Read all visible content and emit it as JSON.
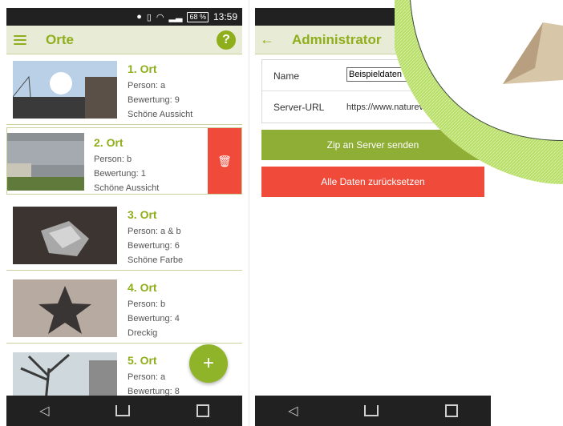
{
  "left_screen": {
    "status": {
      "battery": "68 %",
      "time": "13:59"
    },
    "appbar": {
      "title": "Orte"
    },
    "places": [
      {
        "title": "1. Ort",
        "person": "Person: a",
        "rating": "Bewertung: 9",
        "note": "Schöne Aussicht"
      },
      {
        "title": "2. Ort",
        "person": "Person: b",
        "rating": "Bewertung: 1",
        "note": "Schöne Aussicht"
      },
      {
        "title": "3. Ort",
        "person": "Person: a & b",
        "rating": "Bewertung: 6",
        "note": "Schöne Farbe"
      },
      {
        "title": "4. Ort",
        "person": "Person: b",
        "rating": "Bewertung: 4",
        "note": "Dreckig"
      },
      {
        "title": "5. Ort",
        "person": "Person: a",
        "rating": "Bewertung: 8",
        "note": ""
      }
    ],
    "fab_label": "+"
  },
  "right_screen": {
    "appbar": {
      "title": "Administrator"
    },
    "fields": {
      "name_label": "Name",
      "name_value": "Beispieldaten",
      "server_label": "Server-URL",
      "server_value": "https://www.naturevie"
    },
    "buttons": {
      "send": "Zip an Server senden",
      "reset": "Alle Daten zurücksetzen"
    }
  },
  "colors": {
    "accent": "#8fae1b",
    "delete": "#f04a3a",
    "appbar_bg": "#e8ecd6",
    "system_bar": "#212121"
  },
  "icons": {
    "menu": "menu-icon",
    "help": "help-icon",
    "back": "back-arrow-icon",
    "delete": "trash-icon",
    "nav_back": "nav-back-icon",
    "nav_home": "nav-home-icon",
    "nav_recent": "nav-recent-icon"
  }
}
